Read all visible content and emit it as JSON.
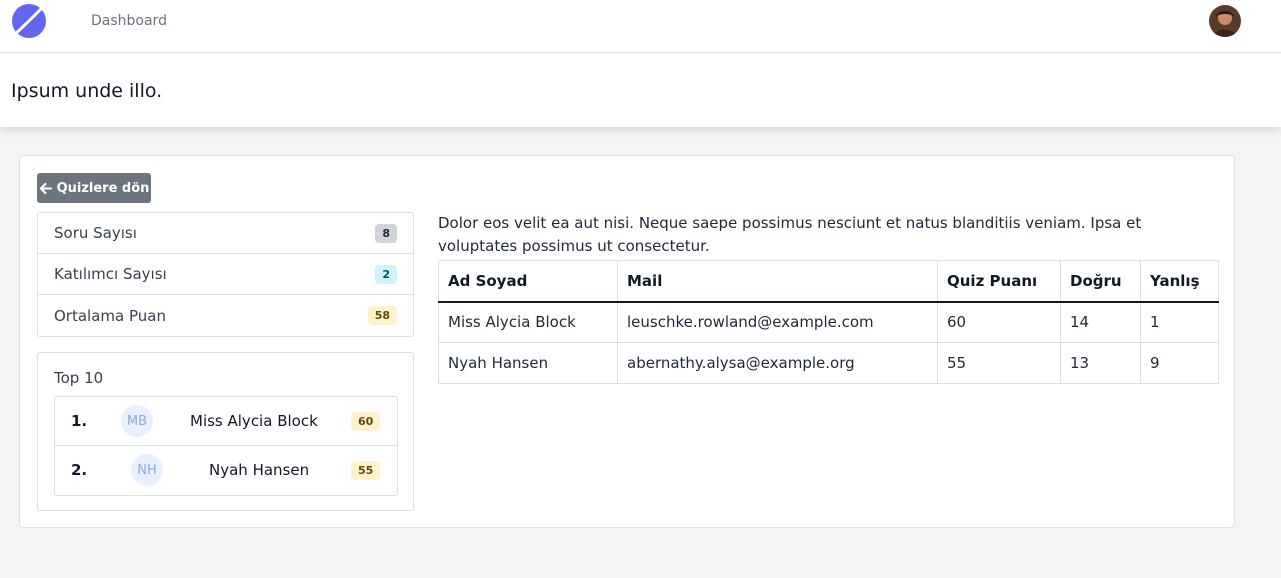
{
  "nav": {
    "dashboard_label": "Dashboard",
    "logo_icon": "planet-logo-icon",
    "avatar_icon": "user-avatar-icon"
  },
  "page": {
    "title": "Ipsum unde illo."
  },
  "back_button": {
    "icon": "arrow-left-icon",
    "label": "Quizlere dön"
  },
  "stats": [
    {
      "label": "Soru Sayısı",
      "value": "8",
      "color": "#d1d5db"
    },
    {
      "label": "Katılımcı Sayısı",
      "value": "2",
      "color": "#cff4fc"
    },
    {
      "label": "Ortalama Puan",
      "value": "58",
      "color": "#fff3cd"
    }
  ],
  "top10": {
    "title": "Top 10",
    "entries": [
      {
        "rank": "1.",
        "initials": "MB",
        "name": "Miss Alycia Block",
        "score": "60"
      },
      {
        "rank": "2.",
        "initials": "NH",
        "name": "Nyah Hansen",
        "score": "55"
      }
    ]
  },
  "description": "Dolor eos velit ea aut nisi. Neque saepe possimus nesciunt et natus blanditiis veniam. Ipsa et voluptates possimus ut consectetur.",
  "table": {
    "headers": [
      "Ad Soyad",
      "Mail",
      "Quiz Puanı",
      "Doğru",
      "Yanlış"
    ],
    "rows": [
      [
        "Miss Alycia Block",
        "leuschke.rowland@example.com",
        "60",
        "14",
        "1"
      ],
      [
        "Nyah Hansen",
        "abernathy.alysa@example.org",
        "55",
        "13",
        "9"
      ]
    ]
  }
}
